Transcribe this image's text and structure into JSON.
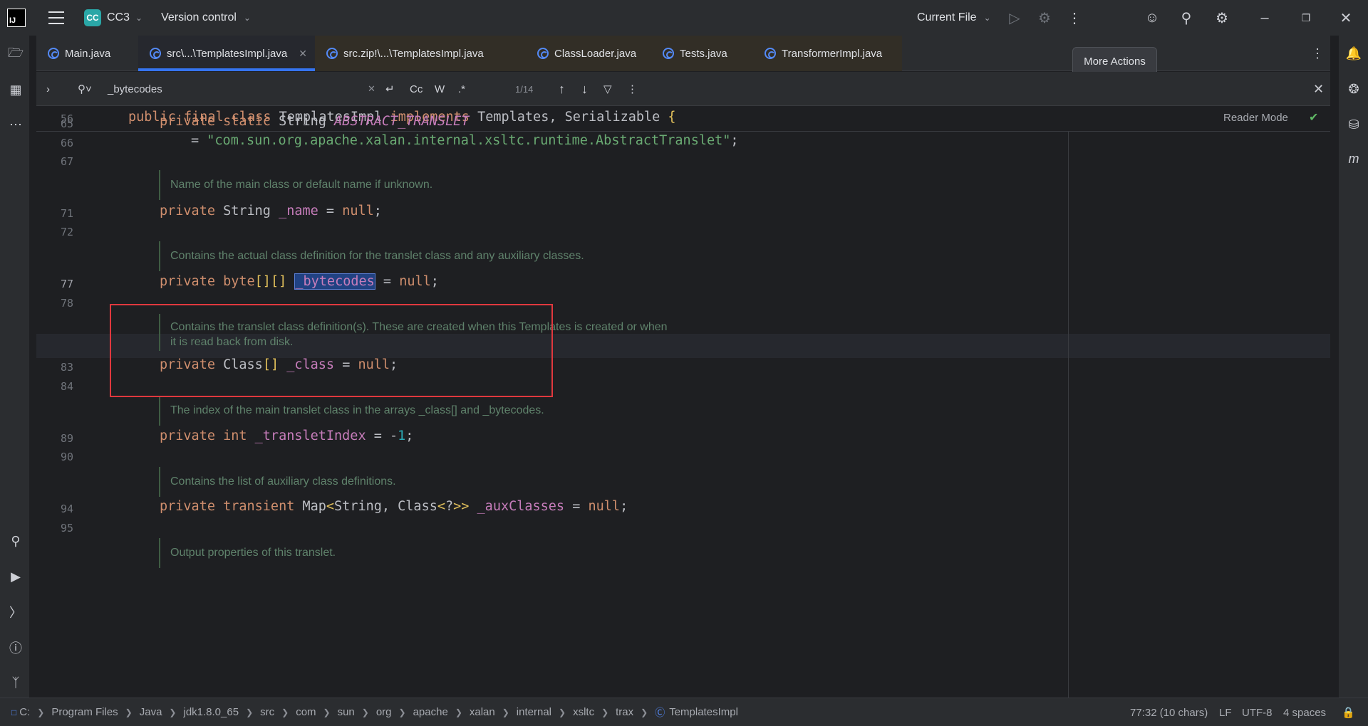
{
  "titlebar": {
    "logo": "IJ",
    "project_badge": "CC",
    "project_name": "CC3",
    "vcs_label": "Version control",
    "run_config": "Current File"
  },
  "tabs": [
    {
      "label": "Main.java"
    },
    {
      "label": "src\\...\\TemplatesImpl.java",
      "active": true
    },
    {
      "label": "src.zip!\\...\\TemplatesImpl.java"
    },
    {
      "label": "ClassLoader.java"
    },
    {
      "label": "Tests.java"
    },
    {
      "label": "TransformerImpl.java"
    }
  ],
  "tooltip": "More Actions",
  "find": {
    "query": "_bytecodes",
    "case_label": "Cc",
    "word_label": "W",
    "regex_label": ".*",
    "match_count": "1/14"
  },
  "editor": {
    "reader_mode": "Reader Mode",
    "sticky_line_no": "56",
    "lines": {
      "n65": "65",
      "n66": "66",
      "n67": "67",
      "n71": "71",
      "n72": "72",
      "n77": "77",
      "n78": "78",
      "n83": "83",
      "n84": "84",
      "n89": "89",
      "n90": "90",
      "n94": "94",
      "n95": "95"
    },
    "docs": {
      "d1": "Name of the main class or default name if unknown.",
      "d2": "Contains the actual class definition for the translet class and any auxiliary classes.",
      "d3a": "Contains the translet class definition(s). These are created when this Templates is created or when",
      "d3b": "it is read back from disk.",
      "d4": "The index of the main translet class in the arrays _class[] and _bytecodes.",
      "d5": "Contains the list of auxiliary class definitions.",
      "d6": "Output properties of this translet."
    }
  },
  "statusbar": {
    "drive": "C:",
    "crumbs": [
      "Program Files",
      "Java",
      "jdk1.8.0_65",
      "src",
      "com",
      "sun",
      "org",
      "apache",
      "xalan",
      "internal",
      "xsltc",
      "trax",
      "TemplatesImpl"
    ],
    "position": "77:32 (10 chars)",
    "line_sep": "LF",
    "encoding": "UTF-8",
    "indent": "4 spaces"
  },
  "colors": {
    "accent": "#3574f0",
    "highlight_box": "#e0383e",
    "keyword": "#cf8e6d",
    "string": "#6aab73",
    "field": "#c77dbb"
  }
}
